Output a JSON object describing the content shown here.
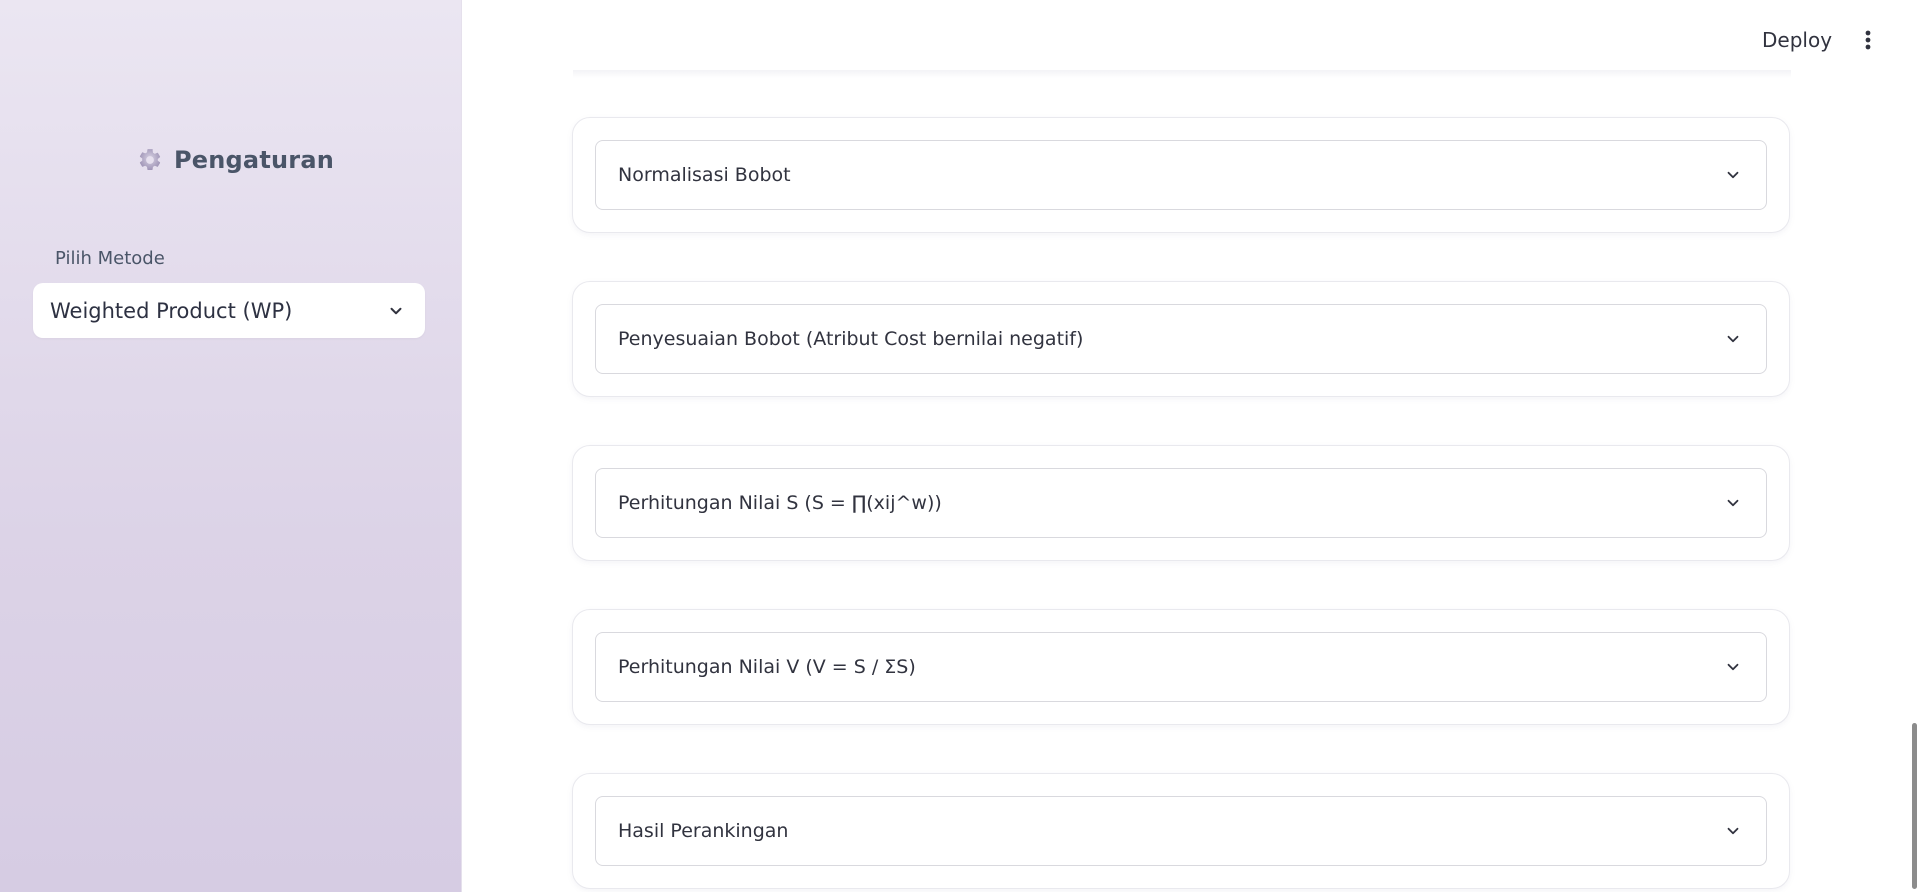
{
  "sidebar": {
    "title": "Pengaturan",
    "icon": "gear-icon",
    "select_label": "Pilih Metode",
    "selected_method": "Weighted Product (WP)"
  },
  "header": {
    "deploy_label": "Deploy",
    "menu_icon": "vertical-dots-icon"
  },
  "sections": [
    {
      "label": "Normalisasi Bobot"
    },
    {
      "label": "Penyesuaian Bobot (Atribut Cost bernilai negatif)"
    },
    {
      "label": "Perhitungan Nilai S (S = ∏(xij^w))"
    },
    {
      "label": "Perhitungan Nilai V (V = S / ΣS)"
    },
    {
      "label": "Hasil Perankingan"
    }
  ],
  "colors": {
    "sidebar_bg": "#e4ddec",
    "text": "#31333f",
    "accent_gear": "#a89cc0"
  }
}
